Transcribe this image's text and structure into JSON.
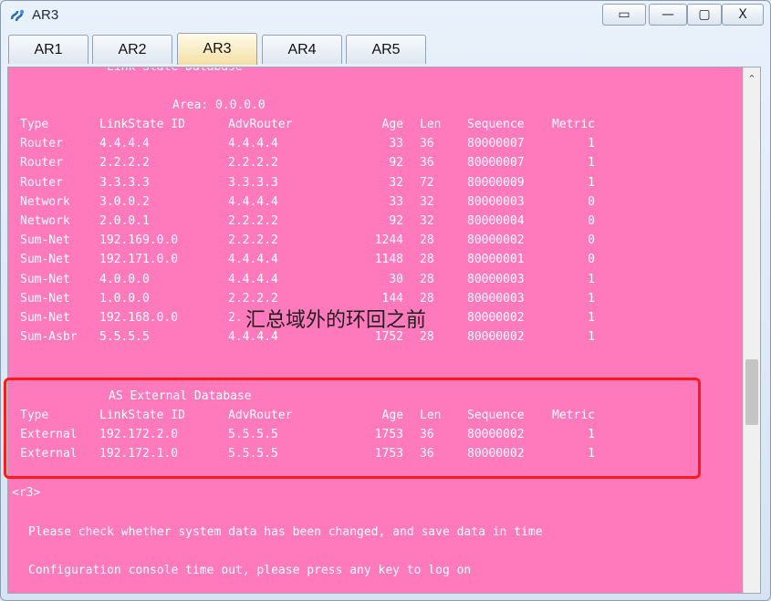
{
  "window": {
    "title": "AR3"
  },
  "controls": {
    "restore": "▭",
    "minimize": "—",
    "maximize": "▢",
    "close": "X"
  },
  "tabs": [
    {
      "label": "AR1"
    },
    {
      "label": "AR2"
    },
    {
      "label": "AR3",
      "active": true
    },
    {
      "label": "AR4"
    },
    {
      "label": "AR5"
    }
  ],
  "console": {
    "section_title": "Link State Database",
    "area": "Area: 0.0.0.0",
    "lsdb_header": [
      "Type",
      "LinkState ID",
      "AdvRouter",
      "Age",
      "Len",
      "Sequence",
      "Metric"
    ],
    "lsdb_rows": [
      [
        "Router",
        "4.4.4.4",
        "4.4.4.4",
        "33",
        "36",
        "80000007",
        "1"
      ],
      [
        "Router",
        "2.2.2.2",
        "2.2.2.2",
        "92",
        "36",
        "80000007",
        "1"
      ],
      [
        "Router",
        "3.3.3.3",
        "3.3.3.3",
        "32",
        "72",
        "80000009",
        "1"
      ],
      [
        "Network",
        "3.0.0.2",
        "4.4.4.4",
        "33",
        "32",
        "80000003",
        "0"
      ],
      [
        "Network",
        "2.0.0.1",
        "2.2.2.2",
        "92",
        "32",
        "80000004",
        "0"
      ],
      [
        "Sum-Net",
        "192.169.0.0",
        "2.2.2.2",
        "1244",
        "28",
        "80000002",
        "0"
      ],
      [
        "Sum-Net",
        "192.171.0.0",
        "4.4.4.4",
        "1148",
        "28",
        "80000001",
        "0"
      ],
      [
        "Sum-Net",
        "4.0.0.0",
        "4.4.4.4",
        "30",
        "28",
        "80000003",
        "1"
      ],
      [
        "Sum-Net",
        "1.0.0.0",
        "2.2.2.2",
        "144",
        "28",
        "80000003",
        "1"
      ],
      [
        "Sum-Net",
        "192.168.0.0",
        "2.",
        "",
        "",
        "80000002",
        "1"
      ],
      [
        "Sum-Asbr",
        "5.5.5.5",
        "4.4.4.4",
        "1752",
        "28",
        "80000002",
        "1"
      ]
    ],
    "ext_title": "AS External Database",
    "ext_header": [
      "Type",
      "LinkState ID",
      "AdvRouter",
      "Age",
      "Len",
      "Sequence",
      "Metric"
    ],
    "ext_rows": [
      [
        "External",
        "192.172.2.0",
        "5.5.5.5",
        "1753",
        "36",
        "80000002",
        "1"
      ],
      [
        "External",
        "192.172.1.0",
        "5.5.5.5",
        "1753",
        "36",
        "80000002",
        "1"
      ]
    ],
    "prompt": "<r3>",
    "msg_save": "Please check whether system data has been changed, and save data in time",
    "msg_timeout": "Configuration console time out, please press any key to log on"
  },
  "annotation": "汇总域外的环回之前",
  "colors": {
    "console_bg": "#ff79bd",
    "highlight": "#ff1a1a"
  }
}
